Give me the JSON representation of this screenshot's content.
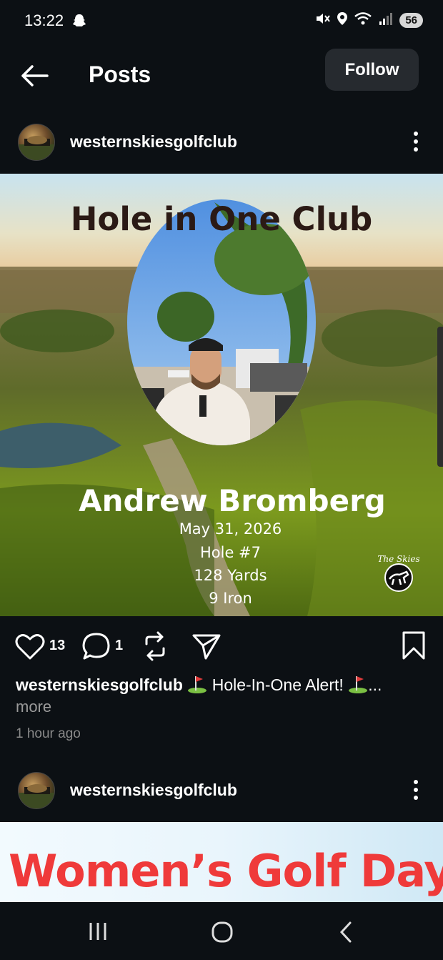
{
  "status": {
    "time": "13:22",
    "battery": "56"
  },
  "header": {
    "title": "Posts",
    "follow_label": "Follow"
  },
  "post1": {
    "username": "westernskiesgolfclub",
    "image": {
      "title": "Hole in One Club",
      "name": "Andrew Bromberg",
      "date": "May 31, 2026",
      "hole": "Hole #7",
      "yards": "128 Yards",
      "club": "9 Iron",
      "logo_text": "The Skies"
    },
    "likes": "13",
    "comments": "1",
    "caption_user": "westernskiesgolfclub",
    "caption_text": "Hole-In-One Alert!",
    "caption_ellipsis": "...",
    "more_label": "more",
    "time_ago": "1 hour ago"
  },
  "post2": {
    "username": "westernskiesgolfclub",
    "image_title": "Women’s Golf  Day"
  },
  "colors": {
    "background": "#0c1014",
    "follow_bg": "#262a2f",
    "accent_red": "#ef3a3a"
  }
}
